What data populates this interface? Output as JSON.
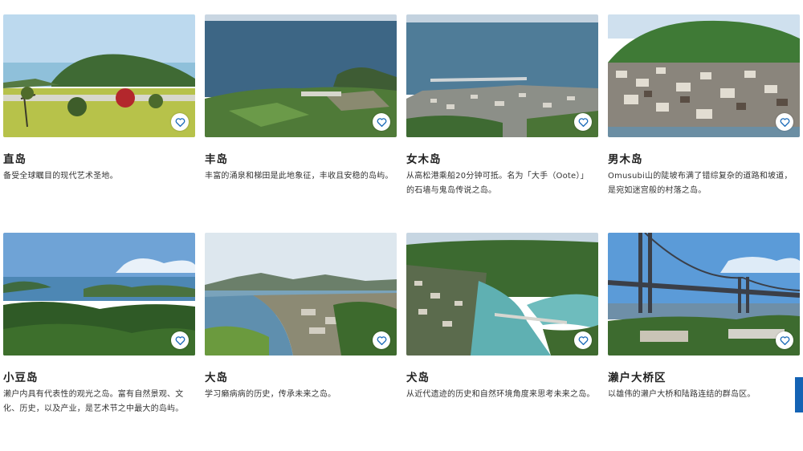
{
  "colors": {
    "favorite": "#1b6bb8",
    "side_tab": "#1463b4"
  },
  "icons": {
    "favorite": "heart-icon"
  },
  "islands": [
    {
      "name": "直岛",
      "desc": "备受全球瞩目的现代艺术圣地。"
    },
    {
      "name": "丰岛",
      "desc": "丰富的涌泉和梯田是此地象征，丰收且安稳的岛屿。"
    },
    {
      "name": "女木岛",
      "desc": "从高松港乘船20分钟可抵。名为「大手（Oote）」的石墙与鬼岛传说之岛。"
    },
    {
      "name": "男木岛",
      "desc": "Omusubi山的陡坡布满了错综复杂的道路和坡道，是宛如迷宫般的村落之岛。"
    },
    {
      "name": "小豆岛",
      "desc": "濑户内具有代表性的观光之岛。富有自然景观、文化、历史，以及产业，是艺术节之中最大的岛屿。"
    },
    {
      "name": "大岛",
      "desc": "学习癞病病的历史，传承未来之岛。"
    },
    {
      "name": "犬岛",
      "desc": "从近代遗迹的历史和自然环境角度来思考未来之岛。"
    },
    {
      "name": "濑户大桥区",
      "desc": "以雄伟的濑户大桥和陆路连结的群岛区。"
    }
  ]
}
